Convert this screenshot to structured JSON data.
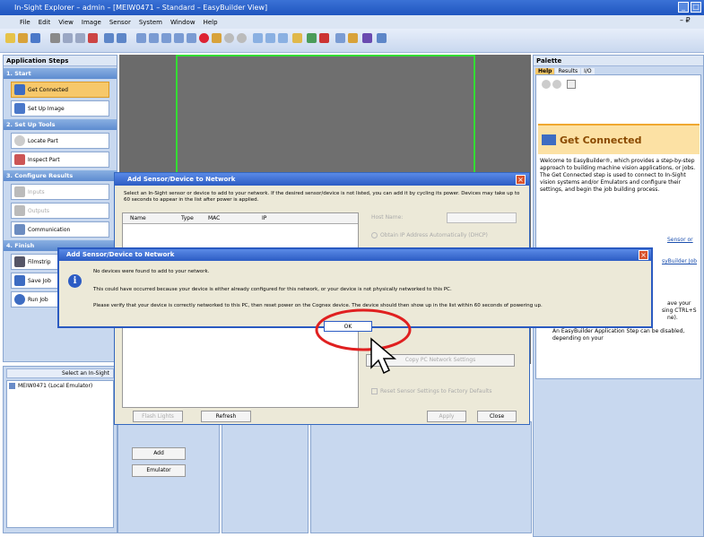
{
  "window": {
    "title": "In-Sight Explorer – admin – [MEIW0471 – Standard – EasyBuilder View]",
    "min": "_",
    "max": "□",
    "menu_restore": "– ₽"
  },
  "menubar": [
    "File",
    "Edit",
    "View",
    "Image",
    "Sensor",
    "System",
    "Window",
    "Help"
  ],
  "app_steps": {
    "title": "Application Steps",
    "sections": [
      {
        "label": "1. Start",
        "items": [
          "Get Connected",
          "Set Up Image"
        ]
      },
      {
        "label": "2. Set Up Tools",
        "items": [
          "Locate Part",
          "Inspect Part"
        ]
      },
      {
        "label": "3. Configure Results",
        "items": [
          "Inputs",
          "Outputs",
          "Communication"
        ]
      },
      {
        "label": "4. Finish",
        "items": [
          "Filmstrip",
          "Save Job",
          "Run Job"
        ]
      }
    ]
  },
  "sensor_panel": {
    "header": "Select an In-Sight",
    "item": "MEIW0471 (Local Emulator)",
    "add_btn": "Add",
    "emulator_btn": "Emulator"
  },
  "palette": {
    "title": "Palette",
    "tabs": [
      "Help",
      "Results",
      "I/O"
    ],
    "help_heading": "Get Connected",
    "help_text": "Welcome to EasyBuilder®, which provides a step-by-step approach to building machine vision applications, or jobs. The Get Connected step is used to connect to In-Sight vision systems and/or Emulators and configure their settings, and begin the job building process.",
    "link1": "Sensor or",
    "link2": "syBuilder Job",
    "partial1": "ave your",
    "partial2": "sing CTRL+S",
    "partial3": "ne).",
    "bullet": "An EasyBuilder Application Step can be disabled, depending on your"
  },
  "add_dialog": {
    "title": "Add Sensor/Device to Network",
    "instructions": "Select an In-Sight sensor or device to add to your network. If the desired sensor/device is not listed, you can add it by cycling its power. Devices may take up to 60 seconds to appear in the list after power is applied.",
    "columns": [
      "Name",
      "Type",
      "MAC",
      "IP"
    ],
    "host_name_label": "Host Name:",
    "dhcp_label": "Obtain IP Address Automatically (DHCP)",
    "copy_btn": "Copy PC Network Settings",
    "reset_label": "Reset Sensor Settings to Factory Defaults",
    "flash_btn": "Flash Lights",
    "refresh_btn": "Refresh",
    "apply_btn": "Apply",
    "close_btn": "Close"
  },
  "msg_dialog": {
    "title": "Add Sensor/Device to Network",
    "line1": "No devices were found to add to your network.",
    "line2": "This could have occurred because your device is either already configured for this network, or your device is not physically networked to this PC.",
    "line3": "Please verify that your device is correctly networked to this PC, then reset power on the Cognex device. The device should then show up in the list within 60 seconds of powering up.",
    "ok": "OK"
  },
  "colors": {
    "accent": "#2c5cc4",
    "highlight_circle": "#e02020",
    "image_frame": "#33dd33",
    "image_bg": "#6b6b6b"
  }
}
